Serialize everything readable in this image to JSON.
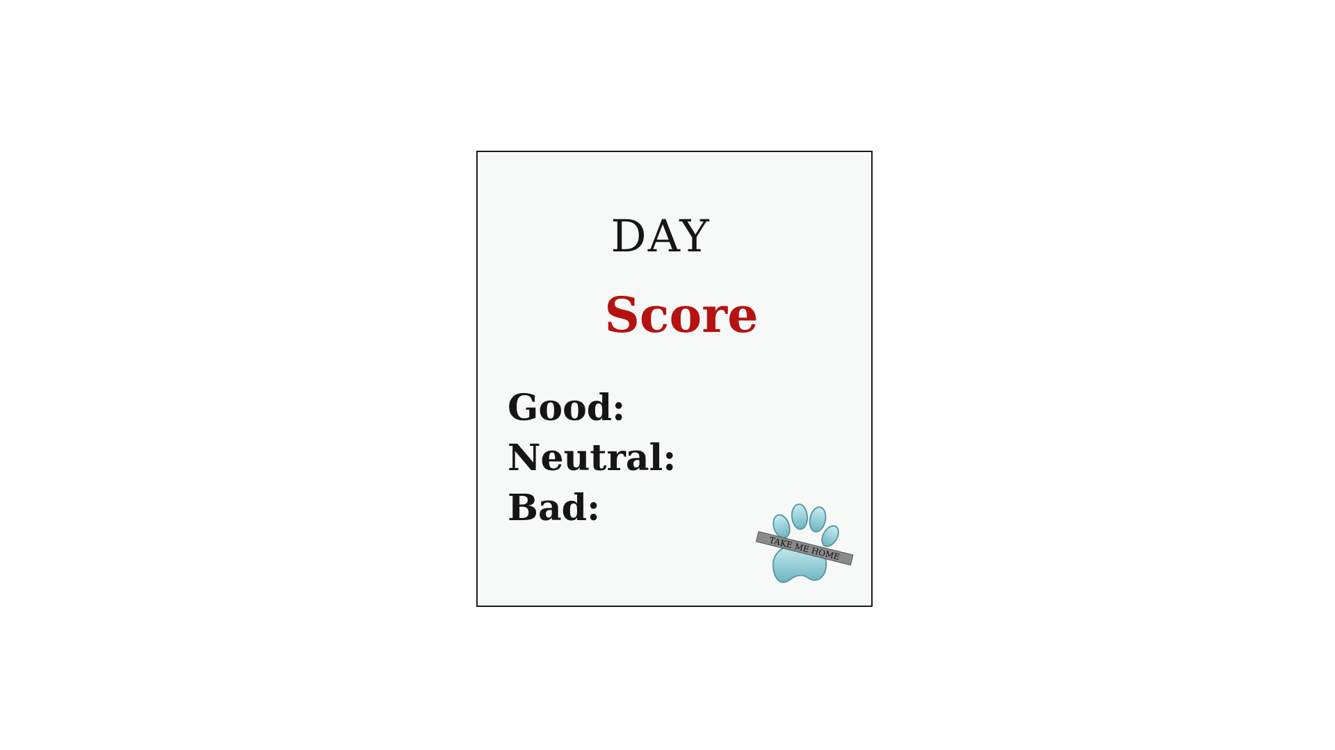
{
  "card": {
    "day_label": "DAY",
    "day_value": "",
    "score_label": "Score",
    "rows": [
      {
        "label": "Good:",
        "value": ""
      },
      {
        "label": "Neutral:",
        "value": ""
      },
      {
        "label": "Bad:",
        "value": ""
      }
    ]
  },
  "logo": {
    "icon": "paw-print-icon",
    "text": "TAKE ME HOME"
  },
  "colors": {
    "background": "#ffffff",
    "card": "#f7f9f8",
    "border": "#1a1a1a",
    "text": "#151515",
    "score_accent": "#b51212",
    "paw": "#8fcfd8"
  }
}
